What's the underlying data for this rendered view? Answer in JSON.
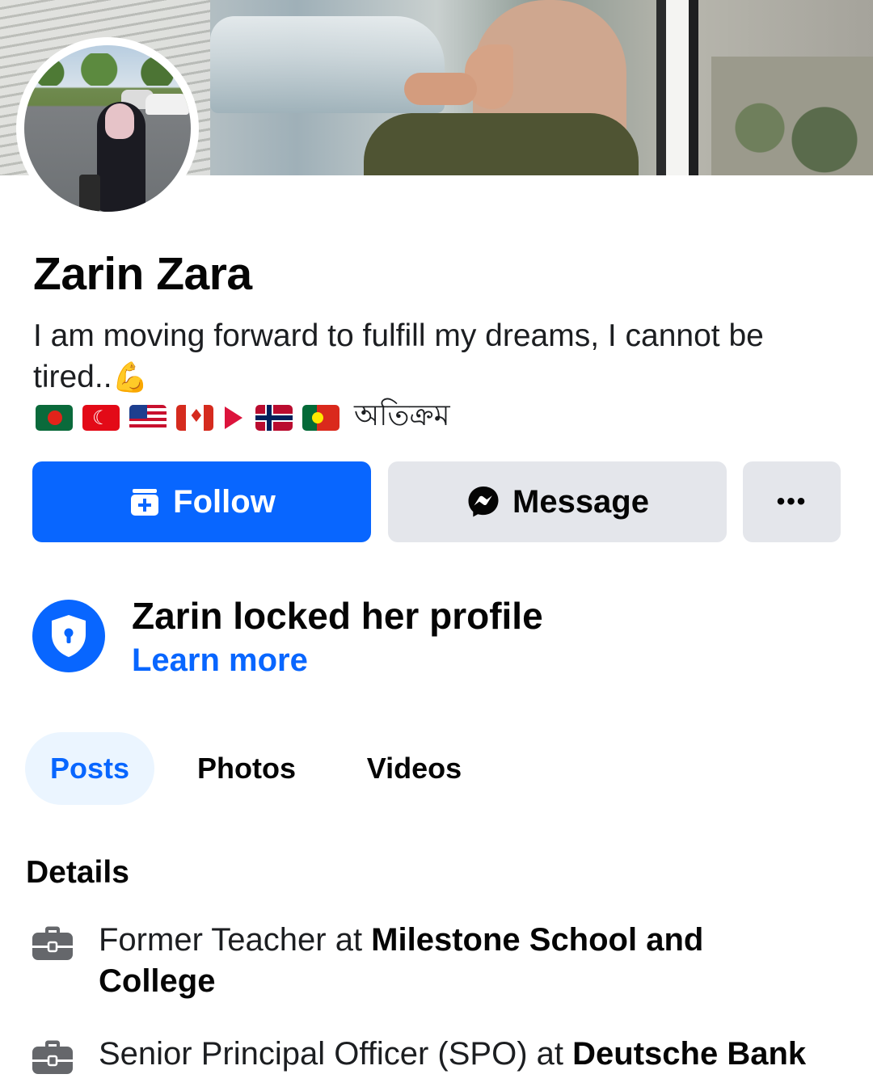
{
  "profile": {
    "name": "Zarin Zara",
    "bio": "I am moving forward to fulfill my dreams, I cannot be tired..",
    "bio_emoji": "💪",
    "flags": [
      "bangladesh",
      "turkey",
      "united-states",
      "canada",
      "nepal",
      "norway",
      "portugal"
    ],
    "flags_caption": "অতিক্রম"
  },
  "actions": {
    "follow_label": "Follow",
    "message_label": "Message",
    "more_label": "•••"
  },
  "lock_notice": {
    "title": "Zarin locked her profile",
    "link_label": "Learn more"
  },
  "tabs": [
    {
      "label": "Posts",
      "active": true
    },
    {
      "label": "Photos",
      "active": false
    },
    {
      "label": "Videos",
      "active": false
    }
  ],
  "details": {
    "title": "Details",
    "items": [
      {
        "prefix": "Former Teacher at ",
        "org": "Milestone School and College",
        "icon": "briefcase-icon"
      },
      {
        "prefix": "Senior Principal Officer (SPO) at ",
        "org": "Deutsche Bank",
        "icon": "briefcase-icon"
      }
    ]
  },
  "colors": {
    "accent": "#0866ff",
    "button_gray": "#e4e6eb",
    "active_tab_bg": "#ebf5ff",
    "text": "#050505"
  }
}
